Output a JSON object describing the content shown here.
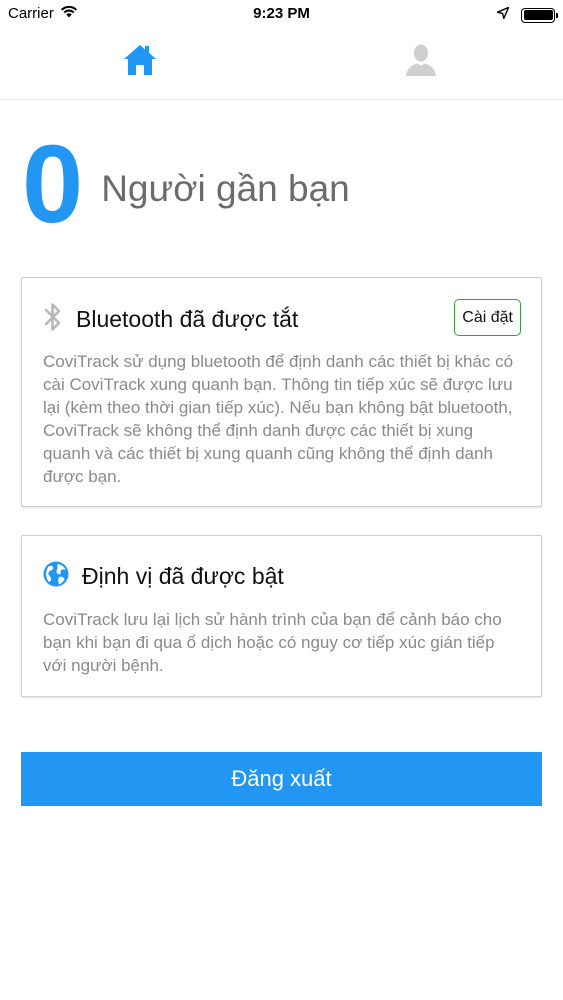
{
  "status_bar": {
    "carrier": "Carrier",
    "time": "9:23 PM"
  },
  "tabs": [
    {
      "name": "home",
      "icon": "home-icon",
      "active": true,
      "color": "#2196f3"
    },
    {
      "name": "profile",
      "icon": "user-icon",
      "active": false,
      "color": "#cfcfcf"
    }
  ],
  "nearby": {
    "count": "0",
    "label": "Người gần bạn",
    "count_color": "#2196f3"
  },
  "bluetooth_card": {
    "icon": "bluetooth-icon",
    "title": "Bluetooth đã được tắt",
    "settings_label": "Cài đặt",
    "description": "CoviTrack sử dụng bluetooth để định danh các thiết bị khác có cài CoviTrack xung quanh bạn. Thông tin tiếp xúc sẽ được lưu lại (kèm theo thời gian tiếp xúc). Nếu bạn không bật bluetooth, CoviTrack sẽ không thể định danh được các thiết bị xung quanh và các thiết bị xung quanh cũng không thể định danh được bạn."
  },
  "location_card": {
    "icon": "globe-icon",
    "title": "Định vị đã được bật",
    "description": "CoviTrack lưu lại lịch sử hành trình của bạn để cảnh báo cho bạn khi bạn đi qua ổ dịch hoặc có nguy cơ tiếp xúc gián tiếp với người bệnh."
  },
  "logout": {
    "label": "Đăng xuất",
    "color": "#2196f3"
  }
}
